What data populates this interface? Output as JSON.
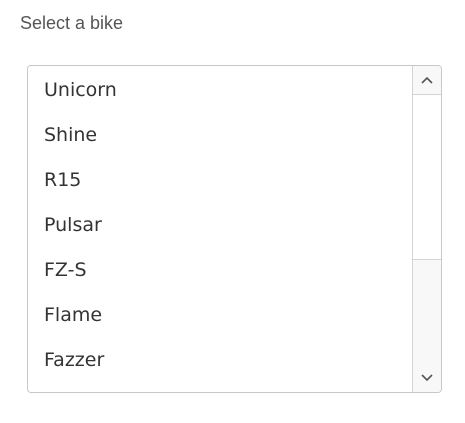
{
  "field": {
    "label": "Select a bike"
  },
  "listbox": {
    "options": [
      "Unicorn",
      "Shine",
      "R15",
      "Pulsar",
      "FZ-S",
      "Flame",
      "Fazzer"
    ]
  },
  "scrollbar": {
    "up_icon": "chevron-up-icon",
    "down_icon": "chevron-down-icon"
  }
}
